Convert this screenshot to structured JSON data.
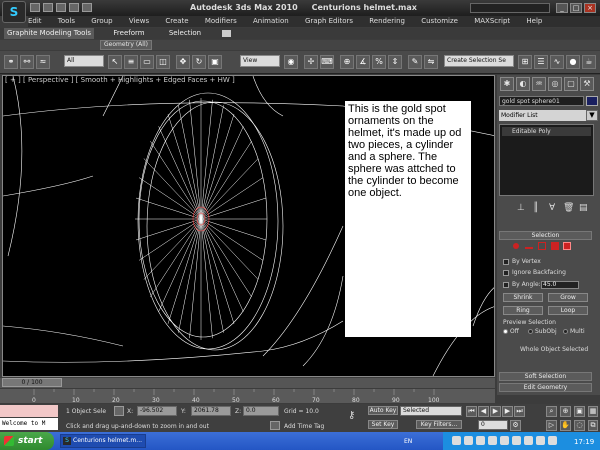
{
  "window": {
    "app_title": "Autodesk 3ds Max  2010",
    "file_title": "Centurions helmet.max",
    "controls": [
      "_",
      "□",
      "×"
    ]
  },
  "menu": [
    "Edit",
    "Tools",
    "Group",
    "Views",
    "Create",
    "Modifiers",
    "Animation",
    "Graph Editors",
    "Rendering",
    "Customize",
    "MAXScript",
    "Help"
  ],
  "ribbon": {
    "tabs": [
      "Graphite Modeling Tools",
      "Freeform",
      "Selection"
    ],
    "subtab": "Geometry (All)"
  },
  "toolbar": {
    "filter_dropdown": "All",
    "view_dropdown": "View",
    "selection_set_placeholder": "Create Selection Se"
  },
  "viewport": {
    "label": "[ + ] [ Perspective ] [ Smooth + Highlights + Edged Faces + HW ]"
  },
  "annotation": {
    "text": "This is the gold spot ornaments on the helmet, it's made up od two pieces, a cylinder and a sphere.  The sphere was attched to the cylinder to become one object."
  },
  "command_panel": {
    "object_name": "gold spot sphere01",
    "object_color": "#1a2060",
    "modifier_list": "Modifier List",
    "stack_item": "Editable Poly",
    "selection_header": "Selection",
    "by_vertex": "By Vertex",
    "ignore_backfacing": "Ignore Backfacing",
    "by_angle": "By Angle:",
    "angle_value": "45.0",
    "shrink": "Shrink",
    "grow": "Grow",
    "ring": "Ring",
    "loop": "Loop",
    "preview_selection": "Preview Selection",
    "preview_off": "Off",
    "preview_subobj": "SubObj",
    "preview_multi": "Multi",
    "whole_object_selected": "Whole Object Selected",
    "soft_selection": "Soft Selection",
    "edit_geometry": "Edit Geometry"
  },
  "timeline": {
    "slider": "0 / 100",
    "ticks": [
      "0",
      "10",
      "20",
      "30",
      "40",
      "50",
      "60",
      "70",
      "80",
      "90",
      "100"
    ]
  },
  "status": {
    "welcome": "Welcome to M",
    "objects_selected": "1 Object Sele",
    "x_label": "X:",
    "x_value": "-96.502",
    "y_label": "Y:",
    "y_value": "2061.78",
    "z_label": "Z:",
    "z_value": "0.0",
    "grid": "Grid = 10.0",
    "prompt": "Click and drag up-and-down to zoom in and out",
    "add_time_tag": "Add Time Tag",
    "auto_key": "Auto Key",
    "selected": "Selected",
    "set_key": "Set Key",
    "key_filters": "Key Filters...",
    "frame": "0"
  },
  "taskbar": {
    "start": "start",
    "task": "Centurions helmet.m...",
    "lang": "EN",
    "clock": "17:19"
  }
}
